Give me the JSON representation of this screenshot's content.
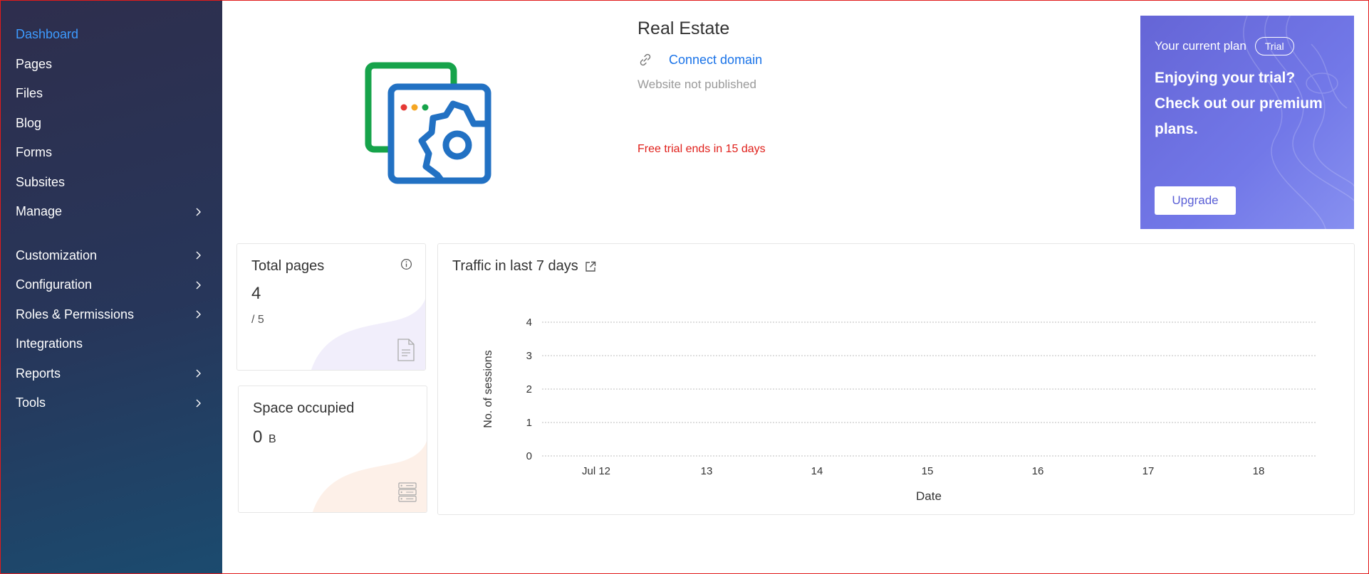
{
  "sidebar": {
    "items": [
      {
        "label": "Dashboard",
        "active": true,
        "has_chevron": false
      },
      {
        "label": "Pages",
        "has_chevron": false
      },
      {
        "label": "Files",
        "has_chevron": false
      },
      {
        "label": "Blog",
        "has_chevron": false
      },
      {
        "label": "Forms",
        "has_chevron": false
      },
      {
        "label": "Subsites",
        "has_chevron": false
      },
      {
        "label": "Manage",
        "has_chevron": true
      },
      {
        "label": "Customization",
        "has_chevron": true
      },
      {
        "label": "Configuration",
        "has_chevron": true
      },
      {
        "label": "Roles & Permissions",
        "has_chevron": true
      },
      {
        "label": "Integrations",
        "has_chevron": false
      },
      {
        "label": "Reports",
        "has_chevron": true
      },
      {
        "label": "Tools",
        "has_chevron": true
      }
    ]
  },
  "site": {
    "title": "Real Estate",
    "connect_label": "Connect domain",
    "status": "Website not published",
    "trial_notice": "Free trial ends in 15 days"
  },
  "plan": {
    "label": "Your current plan",
    "badge": "Trial",
    "message": "Enjoying your trial? Check out our premium plans.",
    "upgrade_label": "Upgrade"
  },
  "stats": {
    "total_pages": {
      "title": "Total pages",
      "value": "4",
      "limit": "/ 5"
    },
    "space": {
      "title": "Space occupied",
      "value": "0",
      "unit": "B"
    }
  },
  "traffic": {
    "title": "Traffic in last 7 days"
  },
  "chart_data": {
    "type": "line",
    "title": "Traffic in last 7 days",
    "xlabel": "Date",
    "ylabel": "No. of sessions",
    "categories": [
      "Jul 12",
      "13",
      "14",
      "15",
      "16",
      "17",
      "18"
    ],
    "series": [
      {
        "values": [
          0,
          0,
          0,
          0,
          0,
          0,
          0
        ]
      }
    ],
    "yticks": [
      0,
      1,
      2,
      3,
      4
    ],
    "ylim": [
      0,
      4
    ],
    "grid": true
  },
  "colors": {
    "accent": "#3d9bff",
    "link": "#1a73e8",
    "alert": "#e0201b",
    "plan_card": "#6a70e0"
  }
}
